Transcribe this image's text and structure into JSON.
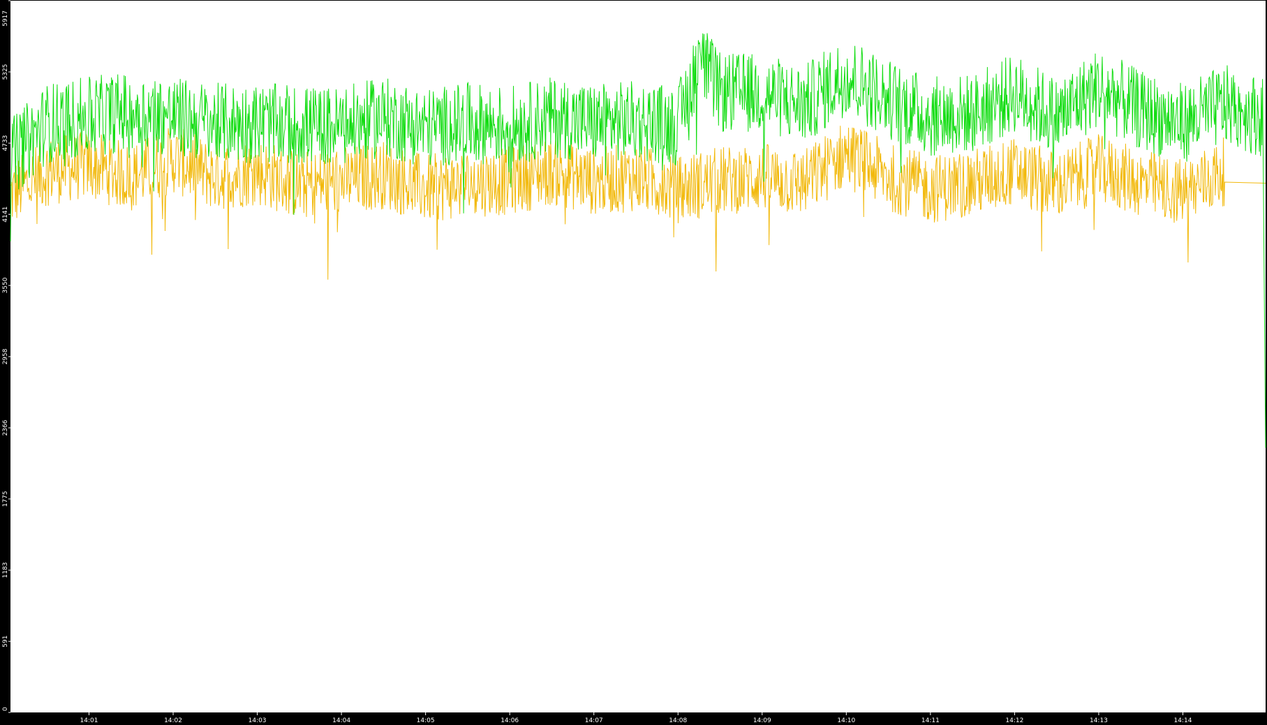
{
  "chart_data": {
    "type": "line",
    "title": "",
    "xlabel": "",
    "ylabel": "",
    "ylim": [
      0,
      5917
    ],
    "grid": false,
    "legend": "none",
    "y_ticks": [
      "0",
      "591",
      "1183",
      "1775",
      "2366",
      "2958",
      "3550",
      "4141",
      "4733",
      "5325",
      "5917"
    ],
    "x_ticks": [
      "14:01",
      "14:02",
      "14:03",
      "14:04",
      "14:05",
      "14:06",
      "14:07",
      "14:08",
      "14:09",
      "14:10",
      "14:11",
      "14:12",
      "14:13",
      "14:14"
    ],
    "x_range": [
      "14:00:04",
      "14:14:59"
    ],
    "series": [
      {
        "color": "#11dd11",
        "x": [
          "14:00:04",
          "14:00:30",
          "14:01:00",
          "14:01:30",
          "14:02:00",
          "14:02:30",
          "14:03:00",
          "14:03:30",
          "14:04:00",
          "14:04:30",
          "14:05:00",
          "14:05:30",
          "14:06:00",
          "14:06:30",
          "14:07:00",
          "14:07:30",
          "14:08:00",
          "14:08:15",
          "14:08:30",
          "14:09:00",
          "14:09:30",
          "14:10:00",
          "14:10:30",
          "14:11:00",
          "14:11:30",
          "14:12:00",
          "14:12:30",
          "14:13:00",
          "14:13:30",
          "14:14:00",
          "14:14:30",
          "14:14:57",
          "14:14:59"
        ],
        "values": [
          4600,
          4900,
          4950,
          5000,
          4950,
          4900,
          4900,
          4880,
          4870,
          4950,
          4860,
          4900,
          4880,
          4950,
          4900,
          4920,
          4880,
          5450,
          5150,
          5150,
          5050,
          5300,
          5100,
          4950,
          4980,
          5150,
          4950,
          5200,
          5000,
          4900,
          5050,
          4950,
          2200
        ]
      },
      {
        "color": "#f2b90c",
        "x": [
          "14:00:04",
          "14:00:30",
          "14:01:00",
          "14:01:30",
          "14:02:00",
          "14:02:30",
          "14:03:00",
          "14:03:30",
          "14:04:00",
          "14:04:30",
          "14:05:00",
          "14:05:30",
          "14:06:00",
          "14:06:30",
          "14:07:00",
          "14:07:30",
          "14:08:00",
          "14:08:30",
          "14:09:00",
          "14:09:30",
          "14:10:00",
          "14:10:30",
          "14:11:00",
          "14:11:30",
          "14:12:00",
          "14:12:30",
          "14:13:00",
          "14:13:30",
          "14:14:00",
          "14:14:30",
          "14:14:59"
        ],
        "values": [
          4300,
          4500,
          4550,
          4450,
          4600,
          4450,
          4500,
          4380,
          4420,
          4470,
          4350,
          4400,
          4420,
          4500,
          4420,
          4450,
          4350,
          4420,
          4450,
          4400,
          4650,
          4450,
          4350,
          4400,
          4500,
          4380,
          4520,
          4400,
          4320,
          4500,
          4400
        ]
      }
    ]
  }
}
